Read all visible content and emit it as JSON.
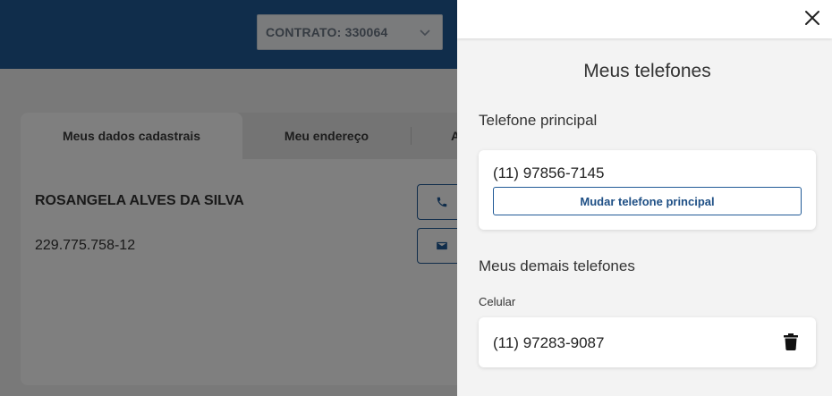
{
  "header": {
    "contract_label": "CONTRATO: 330064"
  },
  "profile_card": {
    "tabs": [
      {
        "label": "Meus dados cadastrais"
      },
      {
        "label": "Meu endereço"
      },
      {
        "label": "A"
      }
    ],
    "name": "ROSANGELA ALVES DA SILVA",
    "cpf": "229.775.758-12",
    "icons": [
      "phone-icon",
      "mail-icon"
    ]
  },
  "drawer": {
    "title": "Meus telefones",
    "primary_section": "Telefone principal",
    "primary_phone": "(11) 97856-7145",
    "change_button": "Mudar telefone principal",
    "other_section": "Meus demais telefones",
    "other_phones": [
      {
        "type": "Celular",
        "number": "(11) 97283-9087"
      }
    ]
  },
  "colors": {
    "primary": "#205a96",
    "overlay": "rgba(0,0,0,0.5)"
  }
}
